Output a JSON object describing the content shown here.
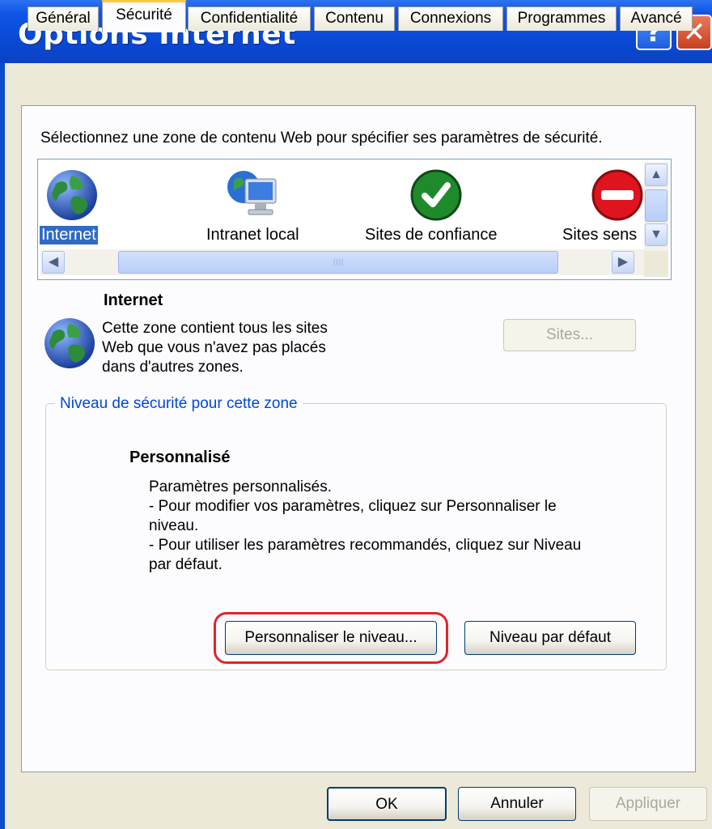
{
  "window": {
    "title": "Options Internet",
    "help_label": "?",
    "close_label": "✕"
  },
  "tabs": [
    {
      "label": "Général"
    },
    {
      "label": "Sécurité"
    },
    {
      "label": "Confidentialité"
    },
    {
      "label": "Contenu"
    },
    {
      "label": "Connexions"
    },
    {
      "label": "Programmes"
    },
    {
      "label": "Avancé"
    }
  ],
  "active_tab": "Sécurité",
  "instruction": "Sélectionnez une zone de contenu Web pour spécifier ses paramètres de sécurité.",
  "zones": [
    {
      "label": "Internet",
      "icon": "globe-icon",
      "selected": true
    },
    {
      "label": "Intranet local",
      "icon": "intranet-icon"
    },
    {
      "label": "Sites de confiance",
      "icon": "green-check-icon"
    },
    {
      "label": "Sites sens",
      "icon": "red-no-entry-icon"
    }
  ],
  "scroll": {
    "up": "▲",
    "down": "▼",
    "left": "◀",
    "right": "▶",
    "thumb_grip": "IIII"
  },
  "zone_info": {
    "title": "Internet",
    "desc_lines": [
      "Cette zone contient tous les sites",
      "Web que vous n'avez pas placés",
      "dans d'autres zones."
    ],
    "sites_button": "Sites..."
  },
  "security_level": {
    "legend": "Niveau de sécurité pour cette zone",
    "level_title": "Personnalisé",
    "desc_lines": [
      "Paramètres personnalisés.",
      "- Pour modifier vos paramètres, cliquez sur Personnaliser le",
      "niveau.",
      "- Pour utiliser les paramètres recommandés, cliquez sur Niveau",
      "par défaut."
    ],
    "custom_button": "Personnaliser le niveau...",
    "default_button": "Niveau par défaut"
  },
  "footer": {
    "ok": "OK",
    "cancel": "Annuler",
    "apply": "Appliquer"
  },
  "colors": {
    "title_bar": "#0a4ad6",
    "highlight_ring": "#e0242c",
    "legend_text": "#0046d5",
    "selection": "#316ac5"
  }
}
